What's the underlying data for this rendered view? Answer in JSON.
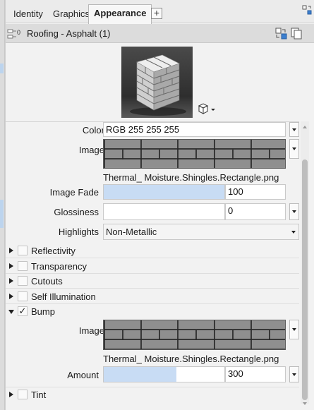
{
  "tabs": [
    {
      "label": "Identity",
      "active": false
    },
    {
      "label": "Graphics",
      "active": false
    },
    {
      "label": "Appearance",
      "active": true
    }
  ],
  "tab_add_label": "+",
  "asset": {
    "link_icon_text": "0",
    "name": "Roofing - Asphalt (1)",
    "icons": [
      "replace-asset-icon",
      "duplicate-asset-icon"
    ]
  },
  "preview": {
    "shape_icon": "cube-icon"
  },
  "properties": {
    "color": {
      "label": "Color",
      "value": "RGB 255 255 255"
    },
    "image": {
      "label": "Image",
      "filename": "Thermal_ Moisture.Shingles.Rectangle.png"
    },
    "image_fade": {
      "label": "Image Fade",
      "value": "100",
      "fill_fraction": 1.0
    },
    "glossiness": {
      "label": "Glossiness",
      "value": "0",
      "fill_fraction": 0.0
    },
    "highlights": {
      "label": "Highlights",
      "value": "Non-Metallic"
    }
  },
  "sections": [
    {
      "label": "Reflectivity",
      "expanded": false,
      "checked": false
    },
    {
      "label": "Transparency",
      "expanded": false,
      "checked": false
    },
    {
      "label": "Cutouts",
      "expanded": false,
      "checked": false
    },
    {
      "label": "Self Illumination",
      "expanded": false,
      "checked": false
    },
    {
      "label": "Bump",
      "expanded": true,
      "checked": true
    },
    {
      "label": "Tint",
      "expanded": false,
      "checked": false
    }
  ],
  "bump": {
    "image_label": "Image",
    "filename": "Thermal_ Moisture.Shingles.Rectangle.png",
    "amount_label": "Amount",
    "amount_value": "300",
    "amount_fill_fraction": 0.6
  },
  "check_glyph": "✓",
  "colors": {
    "accent_fill": "#c8dcf4",
    "panel": "#f2f2f2"
  }
}
